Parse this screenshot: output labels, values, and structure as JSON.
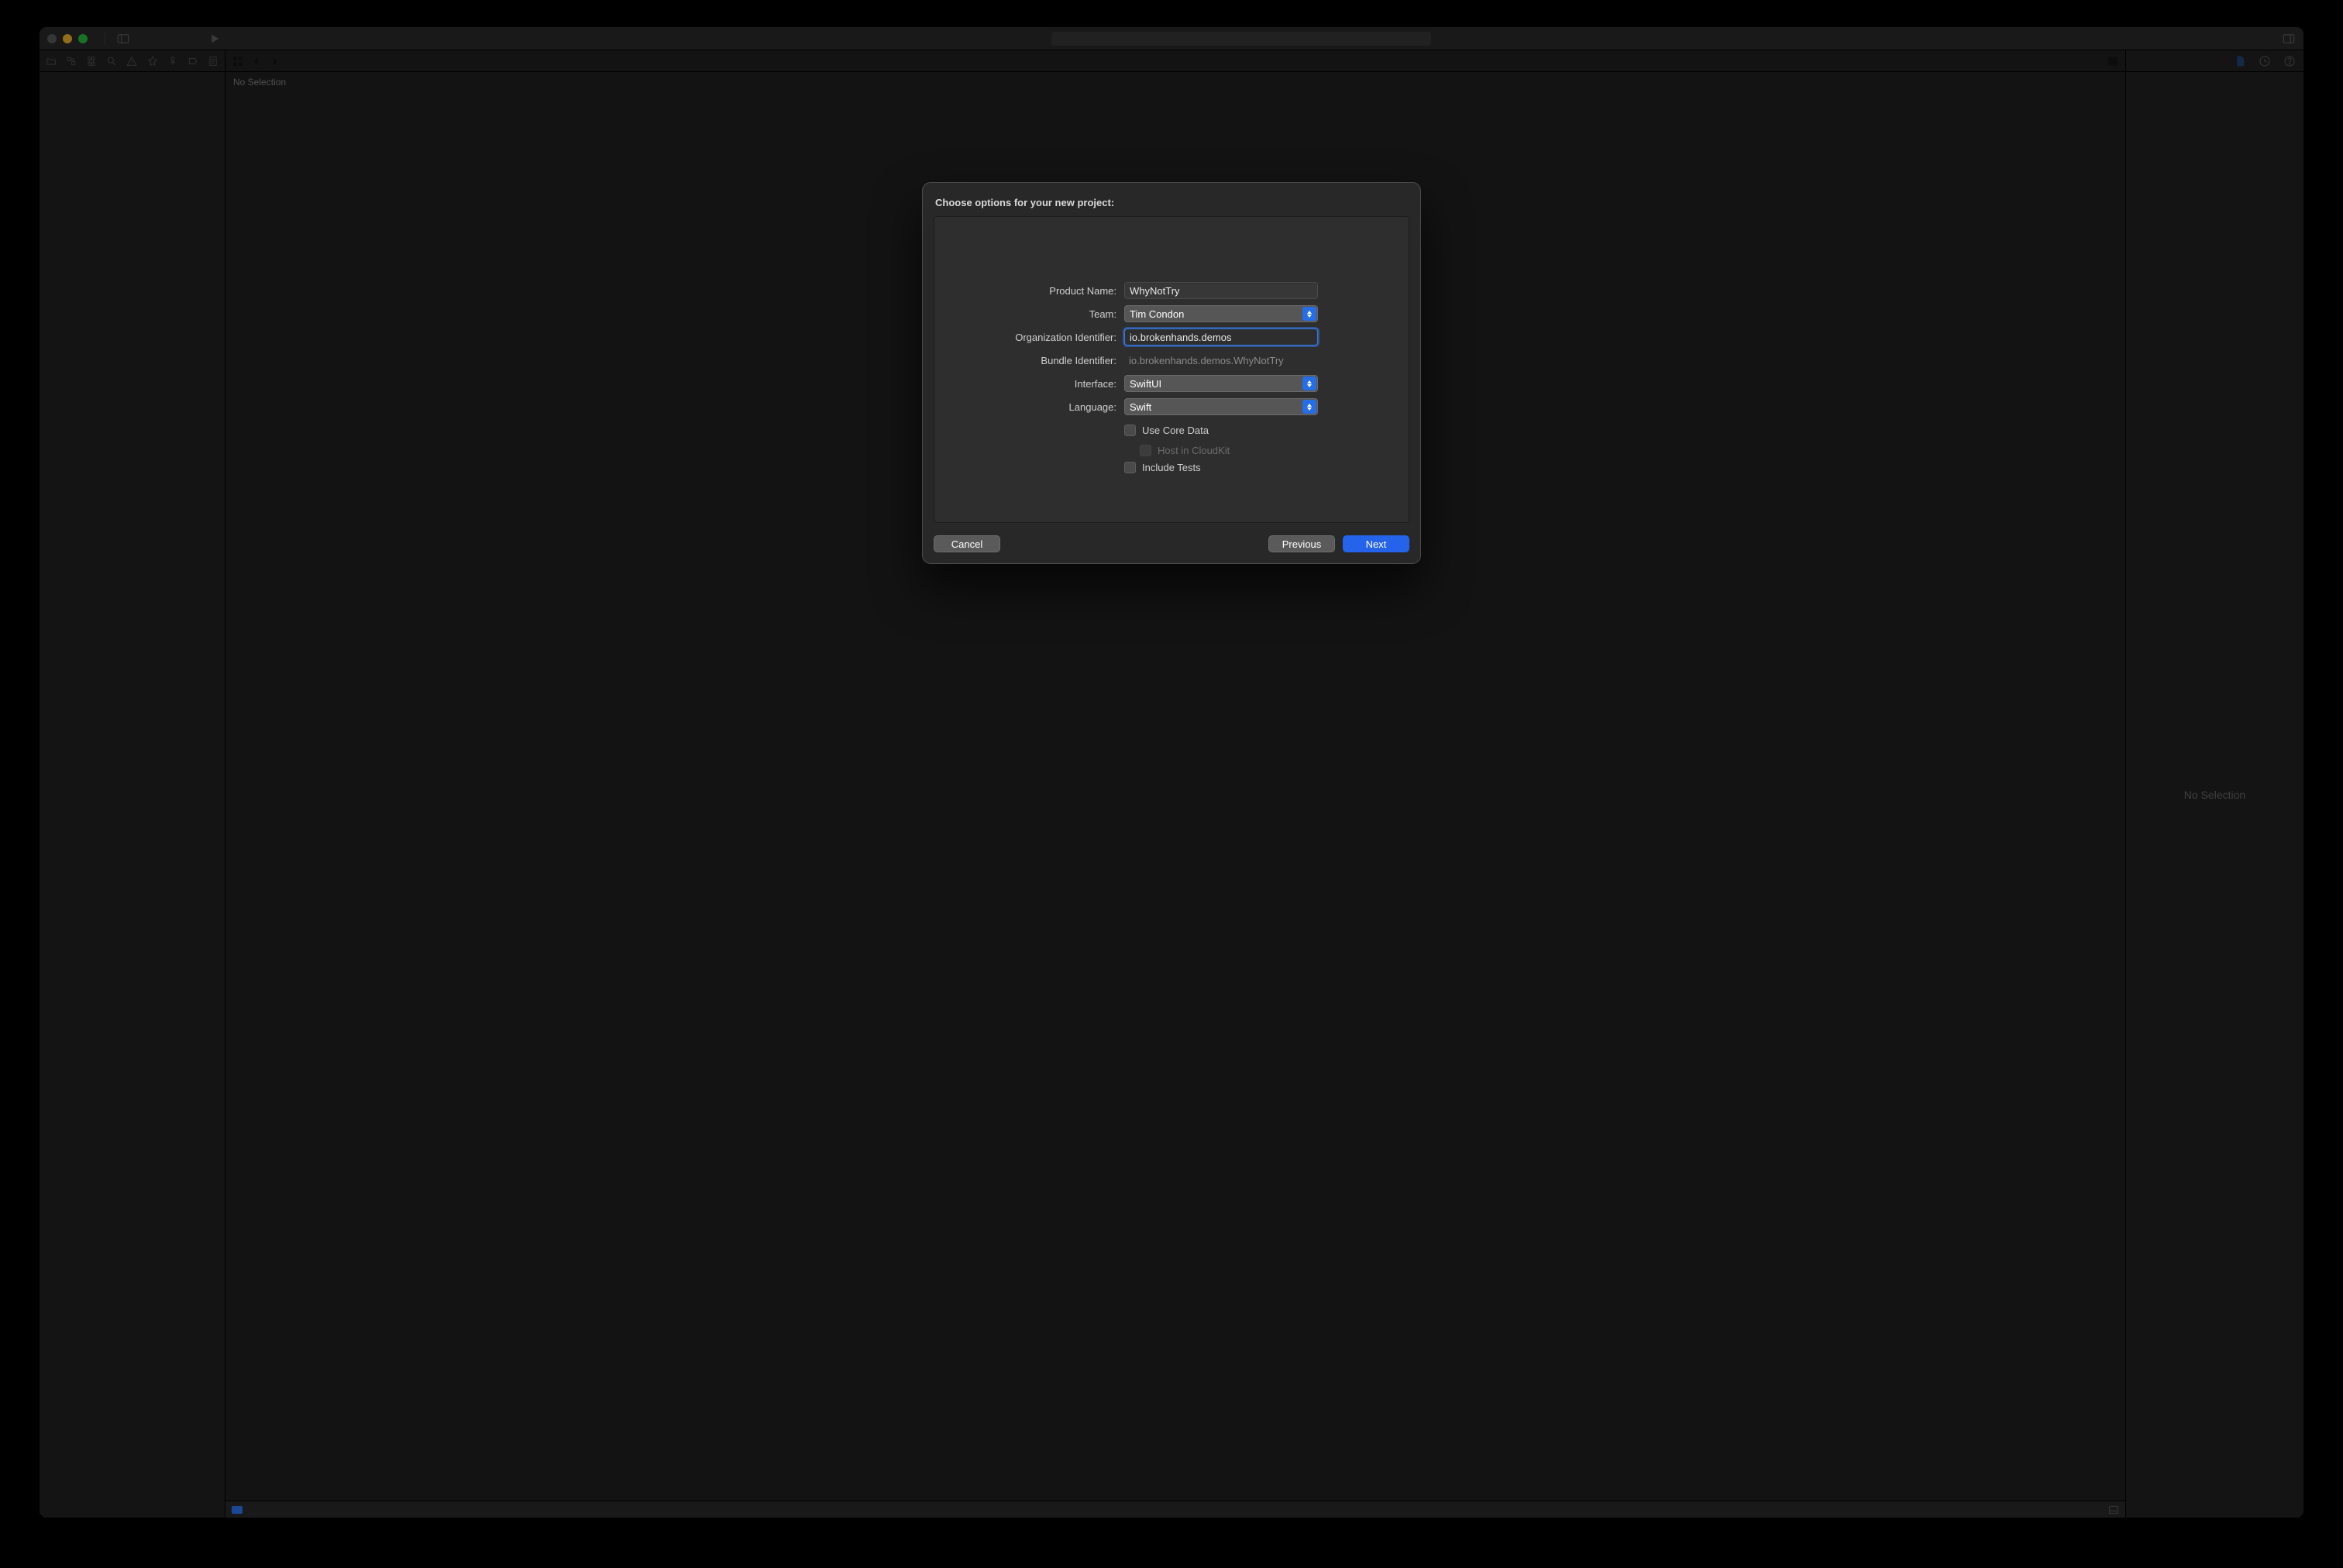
{
  "editor": {
    "no_selection": "No Selection"
  },
  "inspector": {
    "no_selection": "No Selection"
  },
  "sheet": {
    "title": "Choose options for your new project:",
    "labels": {
      "product_name": "Product Name:",
      "team": "Team:",
      "org_id": "Organization Identifier:",
      "bundle_id": "Bundle Identifier:",
      "interface": "Interface:",
      "language": "Language:"
    },
    "values": {
      "product_name": "WhyNotTry",
      "team": "Tim Condon",
      "org_id": "io.brokenhands.demos",
      "bundle_id": "io.brokenhands.demos.WhyNotTry",
      "interface": "SwiftUI",
      "language": "Swift"
    },
    "checks": {
      "use_core_data": "Use Core Data",
      "host_cloudkit": "Host in CloudKit",
      "include_tests": "Include Tests"
    },
    "buttons": {
      "cancel": "Cancel",
      "previous": "Previous",
      "next": "Next"
    }
  }
}
